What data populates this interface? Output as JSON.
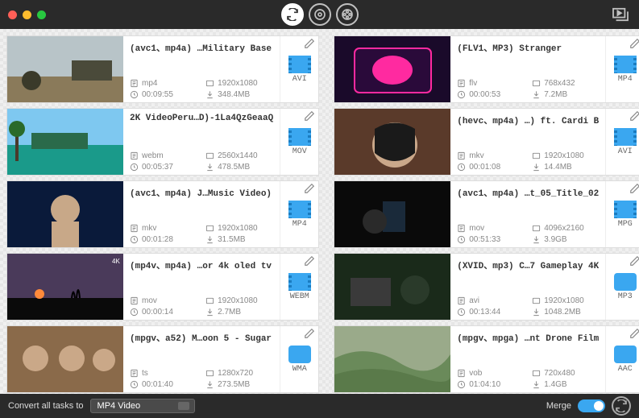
{
  "bottom": {
    "convert_label": "Convert all tasks to",
    "convert_value": "MP4 Video",
    "merge_label": "Merge",
    "merge_on": true
  },
  "items": [
    {
      "title": "(avc1、mp4a) …Military Base",
      "container": "mp4",
      "resolution": "1920x1080",
      "duration": "00:09:55",
      "size": "348.4MB",
      "out": "AVI",
      "out_kind": "video",
      "scene": "war"
    },
    {
      "title": "(FLV1、MP3) Stranger",
      "container": "flv",
      "resolution": "768x432",
      "duration": "00:00:53",
      "size": "7.2MB",
      "out": "MP4",
      "out_kind": "video",
      "scene": "neon"
    },
    {
      "title": "2K VideoPeru…D)-1La4QzGeaaQ",
      "container": "webm",
      "resolution": "2560x1440",
      "duration": "00:05:37",
      "size": "478.5MB",
      "out": "MOV",
      "out_kind": "video",
      "scene": "beach"
    },
    {
      "title": "(hevc、mp4a) …) ft. Cardi B",
      "container": "mkv",
      "resolution": "1920x1080",
      "duration": "00:01:08",
      "size": "14.4MB",
      "out": "AVI",
      "out_kind": "video",
      "scene": "woman"
    },
    {
      "title": "(avc1、mp4a) J…Music Video)",
      "container": "mkv",
      "resolution": "1920x1080",
      "duration": "00:01:28",
      "size": "31.5MB",
      "out": "MP4",
      "out_kind": "video",
      "scene": "singer"
    },
    {
      "title": "(avc1、mp4a) …t_05_Title_02",
      "container": "mov",
      "resolution": "4096x2160",
      "duration": "00:51:33",
      "size": "3.9GB",
      "out": "MPG",
      "out_kind": "video",
      "scene": "dark"
    },
    {
      "title": "(mp4v、mp4a) …or 4k oled tv",
      "container": "mov",
      "resolution": "1920x1080",
      "duration": "00:00:14",
      "size": "2.7MB",
      "out": "WEBM",
      "out_kind": "video",
      "scene": "sunset"
    },
    {
      "title": "(XVID、mp3) C…7 Gameplay 4K",
      "container": "avi",
      "resolution": "1920x1080",
      "duration": "00:13:44",
      "size": "1048.2MB",
      "out": "MP3",
      "out_kind": "audio",
      "scene": "game"
    },
    {
      "title": "(mpgv、a52) M…oon 5 - Sugar",
      "container": "ts",
      "resolution": "1280x720",
      "duration": "00:01:40",
      "size": "273.5MB",
      "out": "WMA",
      "out_kind": "audio",
      "scene": "party"
    },
    {
      "title": "(mpgv、mpga) …nt Drone Film",
      "container": "vob",
      "resolution": "720x480",
      "duration": "01:04:10",
      "size": "1.4GB",
      "out": "AAC",
      "out_kind": "audio",
      "scene": "hills"
    }
  ]
}
